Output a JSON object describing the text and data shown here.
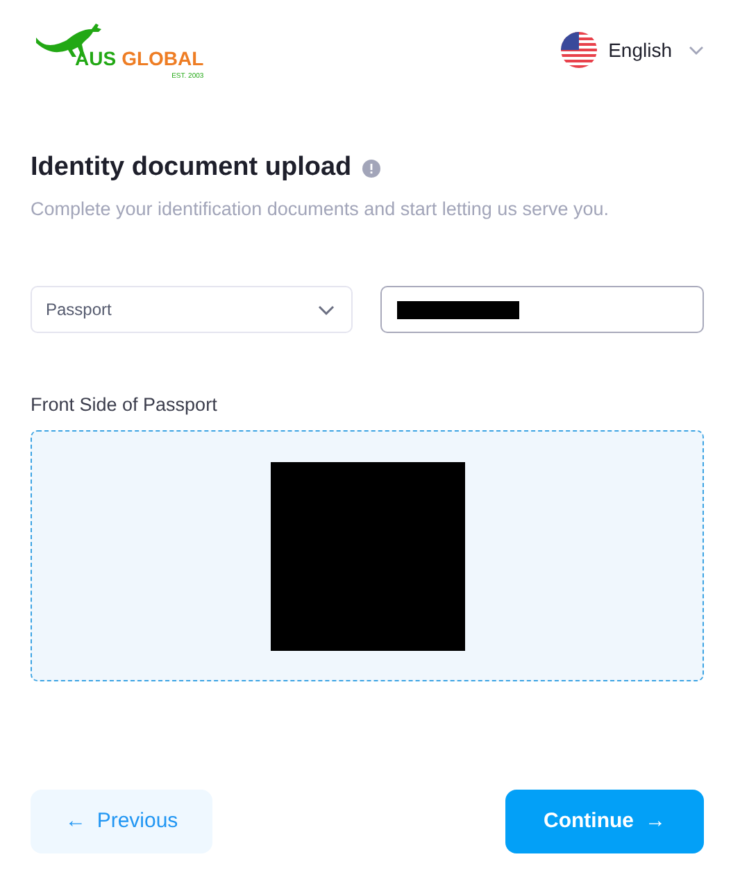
{
  "logo": {
    "name_first": "AUS",
    "name_second": "GLOBAL",
    "tagline": "EST. 2003"
  },
  "language": {
    "label": "English"
  },
  "heading": {
    "title": "Identity document upload",
    "subtitle": "Complete your identification documents and start letting us serve you."
  },
  "document_type": {
    "value": "Passport"
  },
  "upload": {
    "label": "Front Side of Passport"
  },
  "buttons": [
    {
      "kind": "secondary",
      "label": "Previous",
      "arrow": "←"
    },
    {
      "kind": "primary",
      "label": "Continue",
      "arrow": "→"
    }
  ]
}
